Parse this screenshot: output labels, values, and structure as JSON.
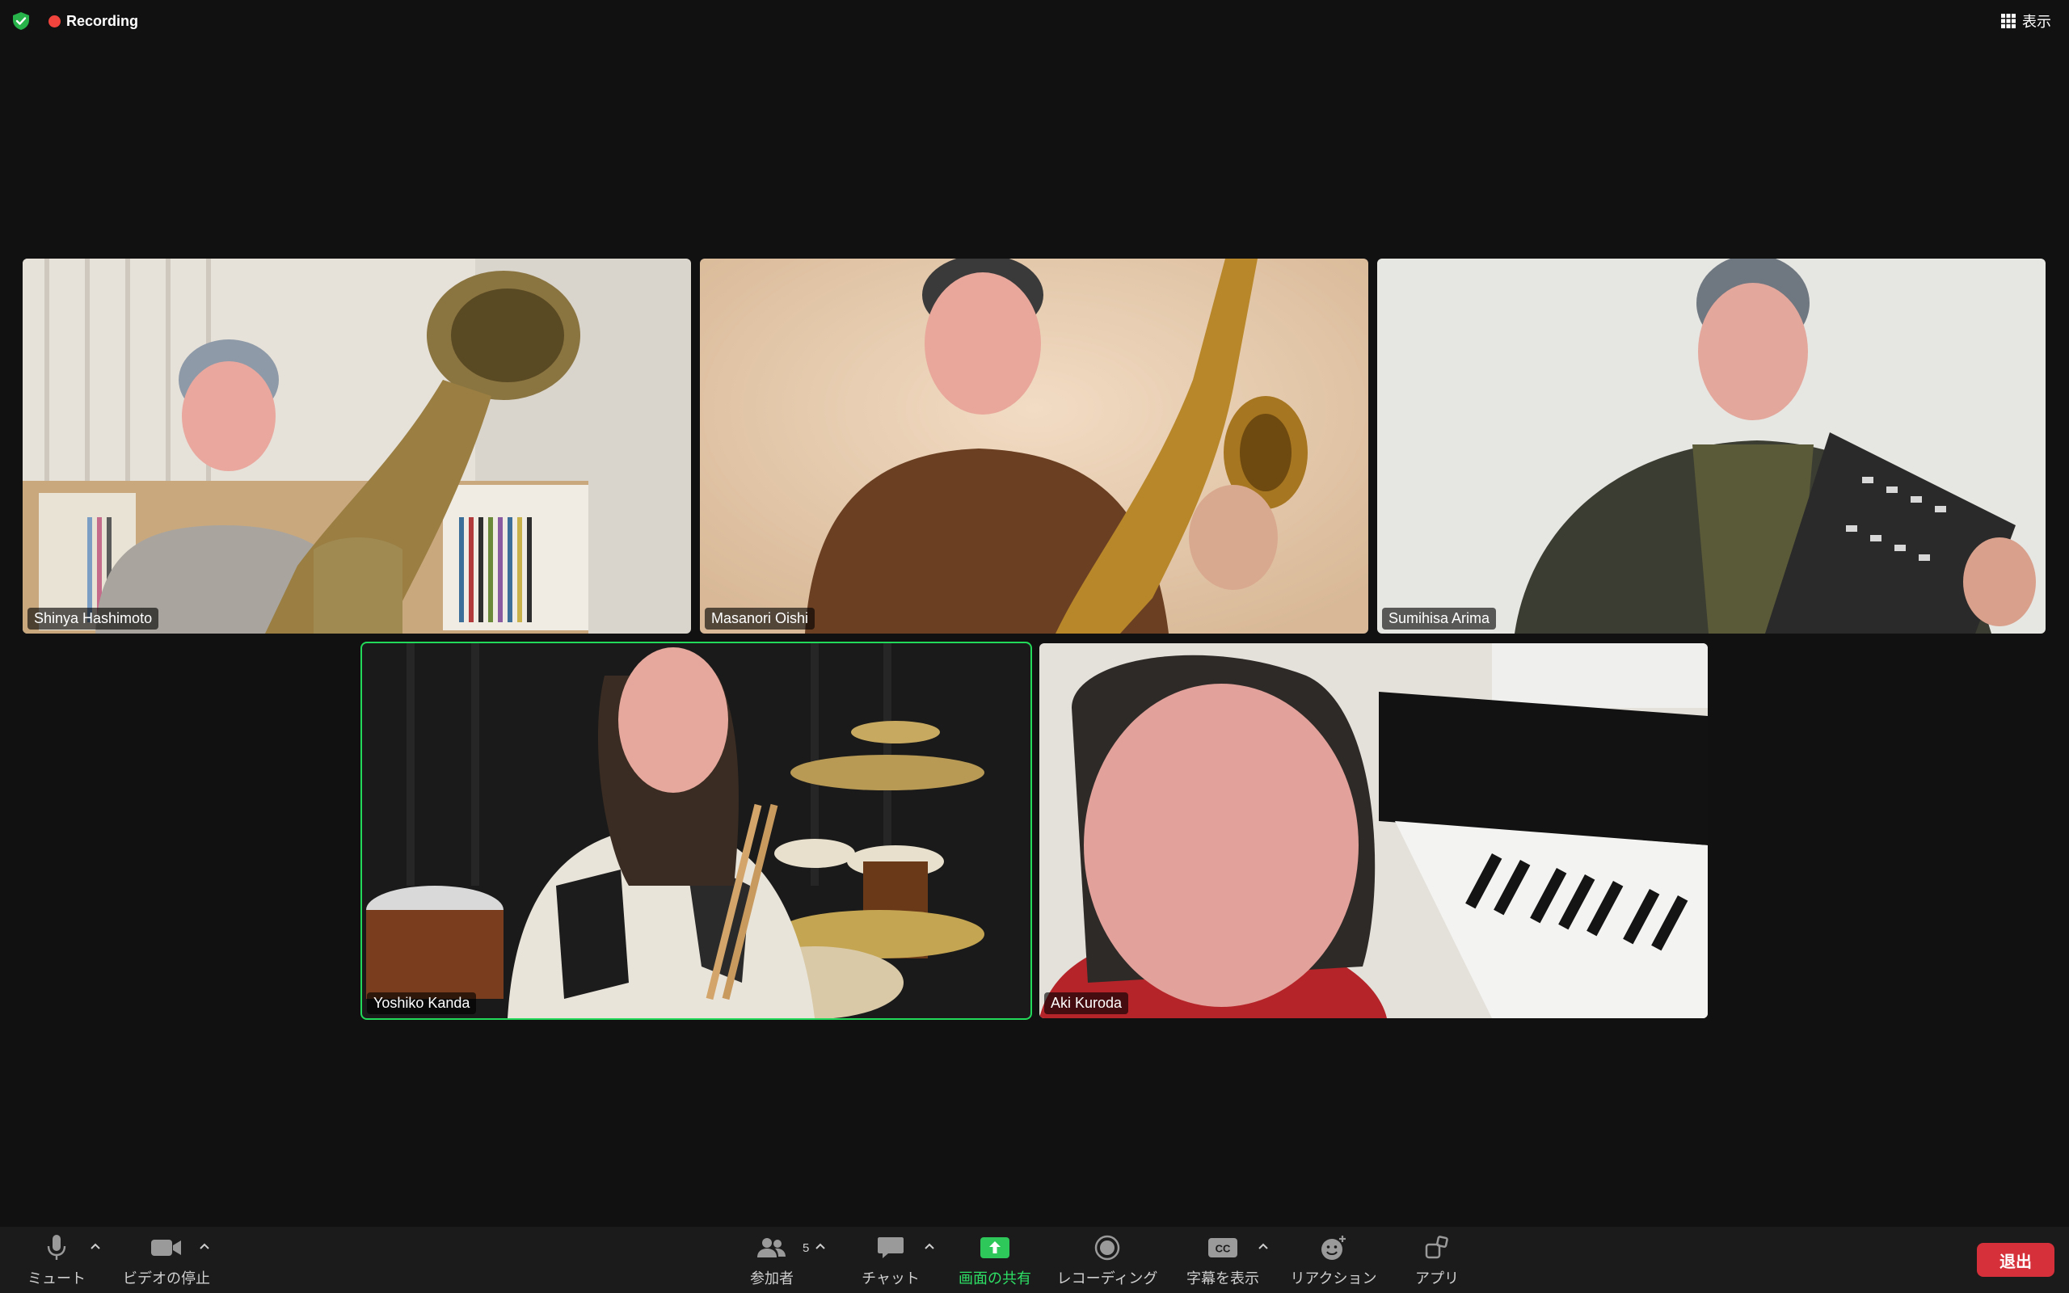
{
  "topbar": {
    "recording_label": "Recording",
    "view_label": "表示",
    "icons": [
      "shield-check-icon",
      "grid-view-icon"
    ]
  },
  "participants": [
    {
      "name": "Shinya Hashimoto",
      "active": false
    },
    {
      "name": "Masanori Oishi",
      "active": false
    },
    {
      "name": "Sumihisa Arima",
      "active": false
    },
    {
      "name": "Yoshiko Kanda",
      "active": true
    },
    {
      "name": "Aki Kuroda",
      "active": false
    }
  ],
  "toolbar": {
    "mute_label": "ミュート",
    "video_label": "ビデオの停止",
    "participants_label": "参加者",
    "participants_count": "5",
    "chat_label": "チャット",
    "share_label": "画面の共有",
    "record_label": "レコーディング",
    "captions_label": "字幕を表示",
    "captions_badge": "CC",
    "reactions_label": "リアクション",
    "apps_label": "アプリ",
    "leave_label": "退出"
  },
  "colors": {
    "background": "#111111",
    "active_speaker": "#23d959",
    "share_green": "#2ee065",
    "leave_red": "#d6303a",
    "recording_dot": "#f0443c"
  }
}
